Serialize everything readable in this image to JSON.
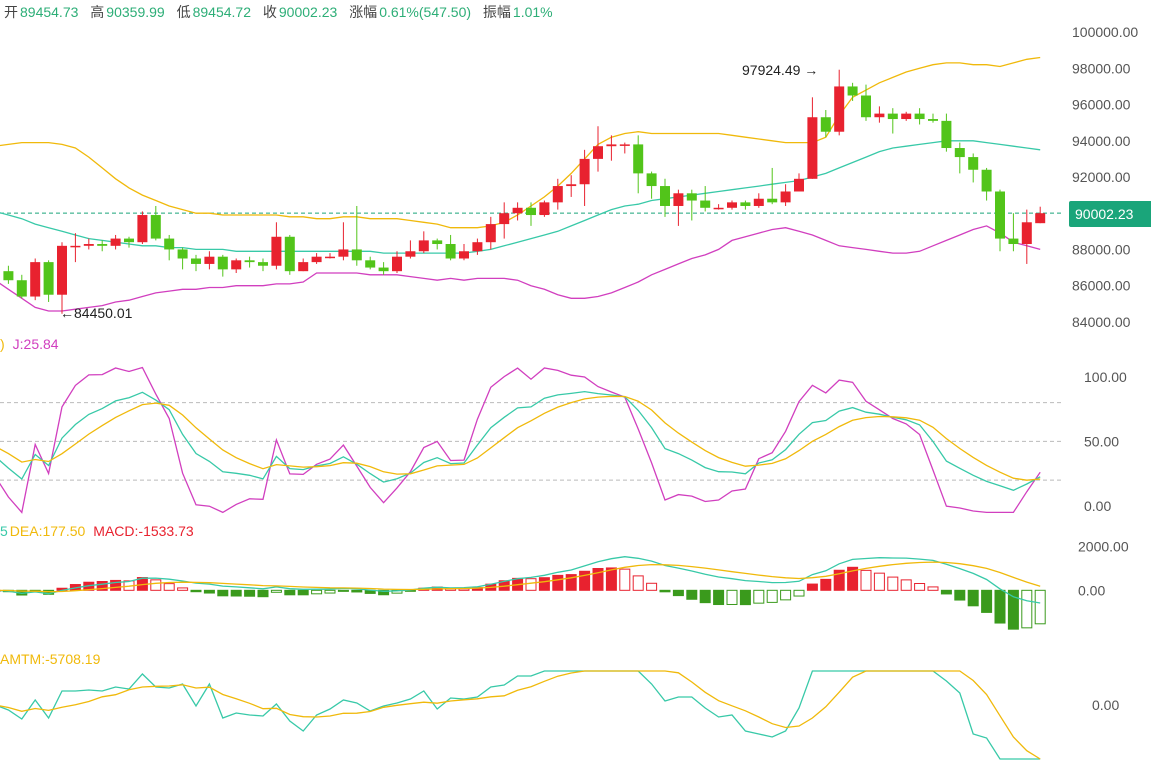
{
  "header": {
    "items": [
      {
        "label": "开",
        "value": "89454.73"
      },
      {
        "label": "高",
        "value": "90359.99"
      },
      {
        "label": "低",
        "value": "89454.72"
      },
      {
        "label": "收",
        "value": "90002.23"
      },
      {
        "label": "涨幅",
        "value": "0.61%(547.50)"
      },
      {
        "label": "振幅",
        "value": "1.01%"
      }
    ]
  },
  "colors": {
    "up": "#e8222f",
    "down": "#52c41a",
    "gold": "#f0b90b",
    "teal": "#38c9a8",
    "magenta": "#d13fbf",
    "price_tag": "#1aa57a",
    "grid_dash": "#bbbbbb"
  },
  "price_tag": "90002.23",
  "annotations": {
    "high_label": "97924.49",
    "low_label": "84450.01"
  },
  "kdj_legend": {
    "j": "J:25.84"
  },
  "macd_legend": {
    "dea": "DEA:177.50",
    "macd": "MACD:-1533.73"
  },
  "mtm_legend": {
    "mamtm": "AMTM:-5708.19"
  },
  "chart_data": [
    {
      "type": "candlestick",
      "name": "price",
      "y_ticks": [
        "100000.00",
        "98000.00",
        "96000.00",
        "94000.00",
        "92000.00",
        "90000.00",
        "88000.00",
        "86000.00",
        "84000.00"
      ],
      "ylim": [
        83000,
        101000
      ],
      "last_close": 90002.23,
      "candles": [
        [
          87600,
          86800,
          87900,
          86600
        ],
        [
          86800,
          86300,
          87100,
          86100
        ],
        [
          86300,
          85400,
          86600,
          85300
        ],
        [
          85400,
          87300,
          87500,
          85200
        ],
        [
          87300,
          85500,
          87400,
          85100
        ],
        [
          85500,
          88200,
          88400,
          84450
        ],
        [
          88200,
          88200,
          88900,
          87300
        ],
        [
          88200,
          88300,
          88600,
          88000
        ],
        [
          88300,
          88200,
          88500,
          87900
        ],
        [
          88200,
          88600,
          88800,
          88000
        ],
        [
          88600,
          88400,
          88700,
          88100
        ],
        [
          88400,
          89900,
          90100,
          88300
        ],
        [
          89900,
          88600,
          90400,
          88500
        ],
        [
          88600,
          88000,
          88800,
          87400
        ],
        [
          88000,
          87500,
          88100,
          86900
        ],
        [
          87500,
          87200,
          87700,
          86800
        ],
        [
          87200,
          87600,
          87900,
          86900
        ],
        [
          87600,
          86900,
          87700,
          86500
        ],
        [
          86900,
          87400,
          87500,
          86700
        ],
        [
          87400,
          87300,
          87600,
          87000
        ],
        [
          87300,
          87100,
          87500,
          86800
        ],
        [
          87100,
          88700,
          89500,
          86900
        ],
        [
          88700,
          86800,
          88800,
          86600
        ],
        [
          86800,
          87300,
          87500,
          86800
        ],
        [
          87300,
          87600,
          87800,
          87200
        ],
        [
          87600,
          87600,
          87800,
          87500
        ],
        [
          87600,
          88000,
          89500,
          87400
        ],
        [
          88000,
          87400,
          90400,
          87100
        ],
        [
          87400,
          87000,
          87600,
          86900
        ],
        [
          87000,
          86800,
          87300,
          86600
        ],
        [
          86800,
          87600,
          87900,
          86700
        ],
        [
          87600,
          87900,
          88500,
          87500
        ],
        [
          87900,
          88500,
          89000,
          87800
        ],
        [
          88500,
          88300,
          88600,
          88000
        ],
        [
          88300,
          87500,
          88800,
          87400
        ],
        [
          87500,
          87900,
          88300,
          87400
        ],
        [
          87900,
          88400,
          88600,
          87700
        ],
        [
          88400,
          89400,
          89800,
          88000
        ],
        [
          89400,
          90000,
          90600,
          88600
        ],
        [
          90000,
          90300,
          90600,
          89600
        ],
        [
          90300,
          89900,
          90600,
          89300
        ],
        [
          89900,
          90600,
          90700,
          89800
        ],
        [
          90600,
          91500,
          91900,
          90200
        ],
        [
          91500,
          91600,
          92100,
          90900
        ],
        [
          91600,
          93000,
          93500,
          90400
        ],
        [
          93000,
          93700,
          94800,
          92300
        ],
        [
          93700,
          93800,
          94300,
          92900
        ],
        [
          93800,
          93800,
          93900,
          93300
        ],
        [
          93800,
          92200,
          94300,
          91100
        ],
        [
          92200,
          91500,
          92300,
          90800
        ],
        [
          91500,
          90400,
          91900,
          89800
        ],
        [
          90400,
          91100,
          91300,
          89300
        ],
        [
          91100,
          90700,
          91300,
          89600
        ],
        [
          90700,
          90300,
          91500,
          90100
        ],
        [
          90300,
          90300,
          90500,
          90200
        ],
        [
          90300,
          90600,
          90700,
          90200
        ],
        [
          90600,
          90400,
          90700,
          90200
        ],
        [
          90400,
          90800,
          91100,
          90300
        ],
        [
          90800,
          90600,
          92500,
          90500
        ],
        [
          90600,
          91200,
          91600,
          90400
        ],
        [
          91200,
          91900,
          92200,
          91400
        ],
        [
          91900,
          95300,
          96400,
          91900
        ],
        [
          95300,
          94500,
          95700,
          94200
        ],
        [
          94500,
          97000,
          97924,
          94300
        ],
        [
          97000,
          96500,
          97200,
          96200
        ],
        [
          96500,
          95300,
          97100,
          95100
        ],
        [
          95300,
          95500,
          95900,
          95000
        ],
        [
          95500,
          95200,
          95800,
          94400
        ],
        [
          95200,
          95500,
          95600,
          95100
        ],
        [
          95500,
          95200,
          95800,
          94900
        ],
        [
          95200,
          95100,
          95500,
          95000
        ],
        [
          95100,
          93600,
          95500,
          93400
        ],
        [
          93600,
          93100,
          93900,
          92200
        ],
        [
          93100,
          92400,
          93300,
          91700
        ],
        [
          92400,
          91200,
          92500,
          90700
        ],
        [
          91200,
          88600,
          91300,
          87900
        ],
        [
          88600,
          88300,
          90000,
          87900
        ],
        [
          88300,
          89500,
          90200,
          87200
        ],
        [
          89450,
          90000,
          90360,
          89450
        ]
      ],
      "bollinger": {
        "upper": [
          93700,
          93800,
          93900,
          93900,
          93900,
          93800,
          93600,
          93100,
          92500,
          91900,
          91400,
          91000,
          90700,
          90400,
          90200,
          90000,
          90000,
          89900,
          89900,
          89900,
          89900,
          89900,
          89800,
          89800,
          89700,
          89700,
          89800,
          89800,
          89700,
          89700,
          89700,
          89600,
          89500,
          89400,
          89200,
          89200,
          89200,
          89300,
          89500,
          89900,
          90400,
          90900,
          91500,
          92200,
          93000,
          93800,
          94200,
          94400,
          94500,
          94400,
          94400,
          94400,
          94400,
          94400,
          94400,
          94300,
          94200,
          94100,
          94000,
          93900,
          93900,
          93900,
          94200,
          95400,
          96400,
          96800,
          97200,
          97500,
          97800,
          98000,
          98200,
          98300,
          98300,
          98200,
          98200,
          98100,
          98300,
          98500,
          98600
        ],
        "middle": [
          90100,
          89900,
          89700,
          89400,
          89200,
          89000,
          88800,
          88600,
          88500,
          88400,
          88300,
          88200,
          88200,
          88100,
          88100,
          88000,
          88000,
          88000,
          87900,
          87900,
          87900,
          87900,
          87900,
          87900,
          87900,
          87900,
          87900,
          87900,
          87900,
          87800,
          87800,
          87800,
          87800,
          87800,
          87800,
          87800,
          87900,
          88000,
          88200,
          88400,
          88600,
          88800,
          89000,
          89300,
          89600,
          89900,
          90200,
          90400,
          90500,
          90700,
          90800,
          90900,
          91000,
          91100,
          91200,
          91300,
          91400,
          91500,
          91600,
          91700,
          91800,
          92000,
          92200,
          92500,
          92800,
          93100,
          93400,
          93600,
          93700,
          93800,
          93900,
          94000,
          94000,
          94000,
          93900,
          93800,
          93700,
          93600,
          93500
        ],
        "lower": [
          86300,
          85800,
          85300,
          84800,
          84600,
          84600,
          84700,
          84800,
          84900,
          85100,
          85200,
          85400,
          85600,
          85700,
          85800,
          85800,
          85900,
          85900,
          86000,
          86000,
          86000,
          86100,
          86100,
          86200,
          86700,
          86700,
          86700,
          86700,
          86600,
          86600,
          86600,
          86500,
          86400,
          86300,
          86400,
          86300,
          86400,
          86400,
          86400,
          86300,
          86000,
          85800,
          85500,
          85300,
          85300,
          85400,
          85600,
          85900,
          86200,
          86600,
          86900,
          87200,
          87500,
          87700,
          88000,
          88500,
          88700,
          88900,
          89100,
          89200,
          89000,
          88800,
          88500,
          88200,
          88100,
          88000,
          87900,
          87800,
          87800,
          87900,
          88200,
          88500,
          88800,
          89100,
          89300,
          88900,
          88400,
          88200,
          88000
        ]
      }
    },
    {
      "type": "line",
      "name": "kdj",
      "y_ticks": [
        "100.00",
        "50.00",
        "0.00"
      ],
      "ylim": [
        -7,
        113
      ],
      "ref_lines": [
        80,
        50,
        20
      ],
      "series": [
        {
          "name": "K",
          "color": "#38c9a8",
          "values": [
            30,
            27,
            25,
            28,
            26,
            42,
            50,
            56,
            60,
            62,
            68,
            80,
            75,
            55,
            42,
            35,
            32,
            30,
            30,
            33,
            34,
            35,
            34,
            30,
            31,
            35,
            42,
            33,
            32,
            38,
            48,
            60,
            63,
            67,
            72,
            78,
            85,
            85,
            84,
            80,
            65,
            45,
            35,
            30,
            28,
            25,
            27,
            35,
            46,
            52,
            60,
            66,
            73,
            78,
            76,
            72,
            68,
            62,
            48,
            25,
            20,
            15,
            12,
            14,
            16,
            18,
            21
          ],
          "placeholder": true
        }
      ]
    },
    {
      "type": "bar",
      "name": "macd",
      "y_ticks": [
        "2000.00",
        "0.00"
      ],
      "ylim": [
        -2500,
        2300
      ]
    },
    {
      "type": "line",
      "name": "mtm",
      "y_ticks": [
        "0.00"
      ],
      "ylim": [
        -5500,
        3500
      ]
    }
  ]
}
